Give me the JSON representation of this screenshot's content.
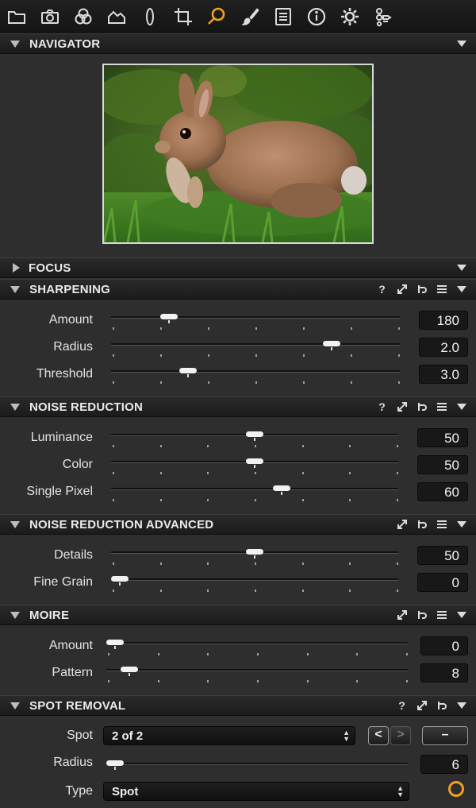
{
  "toolbar": {
    "icons": [
      "folder-icon",
      "camera-icon",
      "color-circles-icon",
      "exposure-icon",
      "lens-icon",
      "crop-icon",
      "details-search-icon",
      "local-adjust-brush-icon",
      "metadata-list-icon",
      "info-icon",
      "settings-gear-icon",
      "batch-icon"
    ],
    "active": "details-search-icon",
    "accent_color": "#f0a020"
  },
  "navigator": {
    "title": "NAVIGATOR"
  },
  "focus": {
    "title": "FOCUS"
  },
  "sharpening": {
    "title": "SHARPENING",
    "help": "?",
    "rows": [
      {
        "label": "Amount",
        "value": "180",
        "level": 0.18
      },
      {
        "label": "Radius",
        "value": "2.0",
        "level": 0.78
      },
      {
        "label": "Threshold",
        "value": "3.0",
        "level": 0.25
      }
    ]
  },
  "noise_reduction": {
    "title": "NOISE REDUCTION",
    "help": "?",
    "rows": [
      {
        "label": "Luminance",
        "value": "50",
        "level": 0.5
      },
      {
        "label": "Color",
        "value": "50",
        "level": 0.5
      },
      {
        "label": "Single Pixel",
        "value": "60",
        "level": 0.6
      }
    ]
  },
  "noise_reduction_advanced": {
    "title": "NOISE REDUCTION ADVANCED",
    "rows": [
      {
        "label": "Details",
        "value": "50",
        "level": 0.5
      },
      {
        "label": "Fine Grain",
        "value": "0",
        "level": 0.0
      }
    ]
  },
  "moire": {
    "title": "MOIRE",
    "rows": [
      {
        "label": "Amount",
        "value": "0",
        "level": 0.0
      },
      {
        "label": "Pattern",
        "value": "8",
        "level": 0.05
      }
    ]
  },
  "spot_removal": {
    "title": "SPOT REMOVAL",
    "help": "?",
    "spot_label": "Spot",
    "spot_value": "2 of 2",
    "prev": "<",
    "next": ">",
    "minus": "–",
    "radius_label": "Radius",
    "radius_value": "6",
    "radius_level": 0.0,
    "type_label": "Type",
    "type_value": "Spot"
  }
}
